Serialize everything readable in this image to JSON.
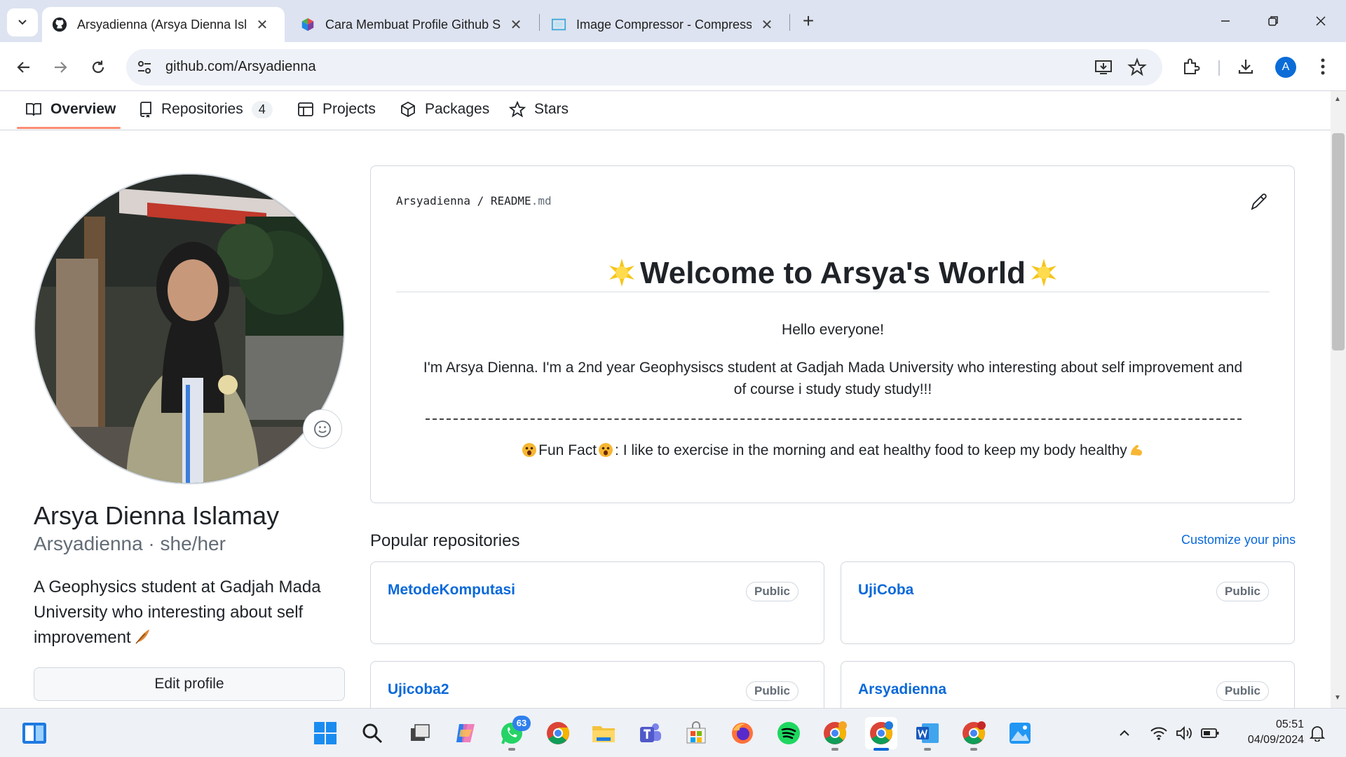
{
  "browser": {
    "tabs": [
      {
        "title": "Arsyadienna (Arsya Dienna Islamay)",
        "active": true
      },
      {
        "title": "Cara Membuat Profile Github Sederhana",
        "active": false
      },
      {
        "title": "Image Compressor - Compress Images",
        "active": false
      }
    ],
    "url": "github.com/Arsyadienna",
    "profile_initial": "A"
  },
  "nav": {
    "overview": "Overview",
    "repositories": "Repositories",
    "repositories_count": "4",
    "projects": "Projects",
    "packages": "Packages",
    "stars": "Stars"
  },
  "profile": {
    "name": "Arsya Dienna Islamay",
    "login_line": "Arsyadienna · she/her",
    "bio": "A Geophysics student at Gadjah Mada University who interesting about self improvement",
    "edit_button": "Edit profile"
  },
  "readme": {
    "owner": "Arsyadienna",
    "sep": "/",
    "file_base": "README",
    "file_ext": ".md",
    "heading": "Welcome to Arsya's World",
    "greeting": "Hello everyone!",
    "intro": "I'm Arsya Dienna. I'm a 2nd year Geophysiscs student at Gadjah Mada University who interesting about self improvement and of course i study study study!!!",
    "fun_fact_label": "Fun Fact",
    "fun_fact_text": ": I like to exercise in the morning and eat healthy food to keep my body healthy"
  },
  "popular": {
    "title": "Popular repositories",
    "customize": "Customize your pins",
    "repos": [
      {
        "name": "MetodeKomputasi",
        "visibility": "Public"
      },
      {
        "name": "UjiCoba",
        "visibility": "Public"
      },
      {
        "name": "Ujicoba2",
        "visibility": "Public"
      },
      {
        "name": "Arsyadienna",
        "visibility": "Public"
      }
    ]
  },
  "taskbar": {
    "whatsapp_badge": "63",
    "time": "05:51",
    "date": "04/09/2024"
  },
  "colors": {
    "link": "#0969da",
    "nav_underline": "#fd8c73",
    "chrome_tabbar": "#dde3f0"
  }
}
